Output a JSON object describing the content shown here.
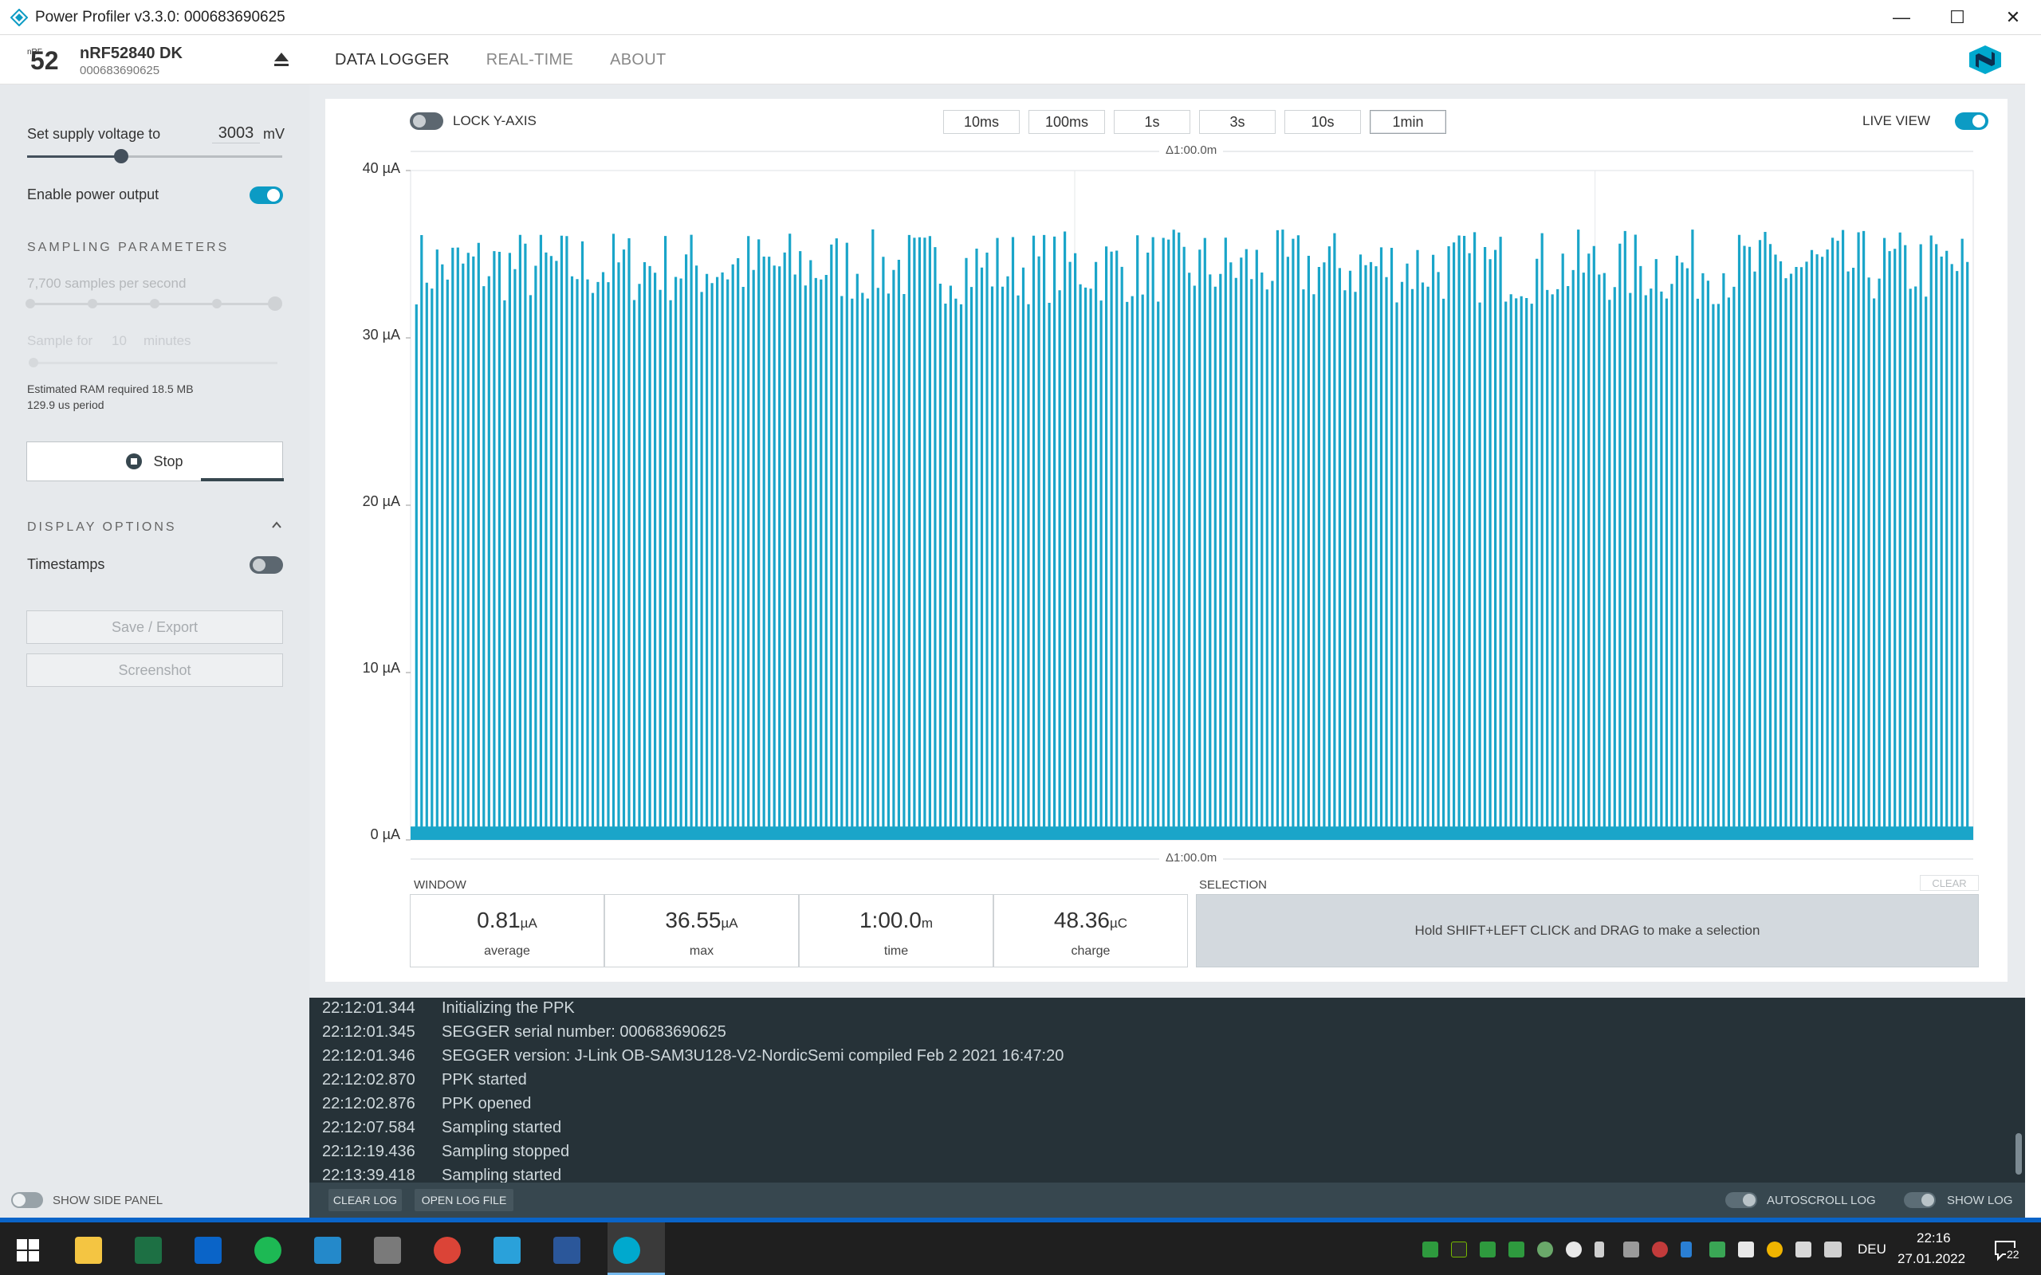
{
  "window": {
    "title": "Power Profiler v3.3.0: 000683690625",
    "controls": [
      "—",
      "☐",
      "✕"
    ]
  },
  "device": {
    "logo_text": "52",
    "logo_sub": "nRF",
    "name": "nRF52840 DK",
    "serial": "000683690625"
  },
  "nav": {
    "tabs": [
      "DATA LOGGER",
      "REAL-TIME",
      "ABOUT"
    ],
    "active": 0
  },
  "side": {
    "supply_label": "Set supply voltage to",
    "supply_value": "3003",
    "supply_unit": "mV",
    "supply_fraction": 0.38,
    "enable_power_label": "Enable power output",
    "enable_power_on": true,
    "sampling_header": "SAMPLING PARAMETERS",
    "samples_per_second": "7,700 samples per second",
    "sample_for_prefix": "Sample for",
    "sample_for_value": "10",
    "sample_for_unit": "minutes",
    "ram_text": "Estimated RAM required 18.5 MB",
    "period_text": "129.9 us period",
    "stop_label": "Stop",
    "display_header": "DISPLAY OPTIONS",
    "timestamps_label": "Timestamps",
    "timestamps_on": false,
    "save_label": "Save / Export",
    "screenshot_label": "Screenshot"
  },
  "chart_controls": {
    "lock_label": "LOCK Y-AXIS",
    "live_label": "LIVE VIEW",
    "time_buttons": [
      "10ms",
      "100ms",
      "1s",
      "3s",
      "10s",
      "1min"
    ],
    "active_time": 5,
    "delta_top": "Δ1:00.0m",
    "delta_bottom": "Δ1:00.0m"
  },
  "chart_data": {
    "type": "line",
    "y_ticks": [
      "40 µA",
      "30 µA",
      "20 µA",
      "10 µA",
      "0 µA"
    ],
    "ylim": [
      0,
      40
    ],
    "x_range": [
      "0:00.0",
      "1:00.0"
    ],
    "baseline_uA": 0.5,
    "spike_peak_range_uA": [
      32,
      36.5
    ],
    "spike_count_approx": 300,
    "color": "#1aa5c9",
    "grid": true
  },
  "window_stats": {
    "header": "WINDOW",
    "items": [
      {
        "value": "0.81",
        "unit": "µA",
        "label": "average"
      },
      {
        "value": "36.55",
        "unit": "µA",
        "label": "max"
      },
      {
        "value": "1:00.0",
        "unit": "m",
        "label": "time"
      },
      {
        "value": "48.36",
        "unit": "µC",
        "label": "charge"
      }
    ]
  },
  "selection": {
    "header": "SELECTION",
    "clear_label": "CLEAR",
    "hint": "Hold SHIFT+LEFT CLICK and DRAG to make a selection"
  },
  "log": {
    "entries": [
      {
        "ts": "22:12:01.344",
        "msg": "Initializing the PPK"
      },
      {
        "ts": "22:12:01.345",
        "msg": "SEGGER serial number: 000683690625"
      },
      {
        "ts": "22:12:01.346",
        "msg": "SEGGER version: J-Link OB-SAM3U128-V2-NordicSemi compiled Feb 2 2021 16:47:20"
      },
      {
        "ts": "22:12:02.870",
        "msg": "PPK started"
      },
      {
        "ts": "22:12:02.876",
        "msg": "PPK opened"
      },
      {
        "ts": "22:12:07.584",
        "msg": "Sampling started"
      },
      {
        "ts": "22:12:19.436",
        "msg": "Sampling stopped"
      },
      {
        "ts": "22:13:39.418",
        "msg": "Sampling started"
      }
    ]
  },
  "footer": {
    "show_side_panel": "SHOW SIDE PANEL",
    "clear_log": "CLEAR LOG",
    "open_log_file": "OPEN LOG FILE",
    "autoscroll_log": "AUTOSCROLL LOG",
    "show_log": "SHOW LOG"
  },
  "taskbar": {
    "apps": [
      {
        "name": "file-explorer-icon",
        "color": "#f4c542"
      },
      {
        "name": "excel-icon",
        "color": "#1d7044"
      },
      {
        "name": "outlook-icon",
        "color": "#0a64c8"
      },
      {
        "name": "spotify-icon",
        "color": "#1db954"
      },
      {
        "name": "vscode-icon",
        "color": "#2489ca"
      },
      {
        "name": "network-tool-icon",
        "color": "#7a7a7a"
      },
      {
        "name": "chrome-icon",
        "color": "#db4437"
      },
      {
        "name": "telegram-icon",
        "color": "#2aa1da"
      },
      {
        "name": "word-icon",
        "color": "#2b579a"
      },
      {
        "name": "nrf-connect-icon",
        "color": "#00a9ce"
      }
    ],
    "language": "DEU",
    "time": "22:16",
    "date": "27.01.2022",
    "notifications": "22"
  }
}
